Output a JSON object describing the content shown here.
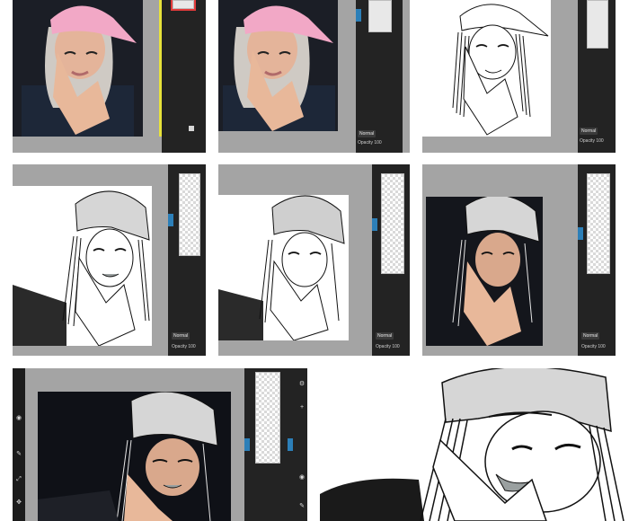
{
  "layer_panel": {
    "blend_mode": "Normal",
    "opacity_label": "Opacity 100"
  },
  "icons": {
    "trash": "trash-icon",
    "eye": "eye-icon",
    "brush": "brush-icon",
    "settings": "gear-icon",
    "add_layer": "add-layer-icon"
  },
  "colors": {
    "workspace_gray": "#a4a4a4",
    "panel_dark": "#232323",
    "accent_blue": "#2c7fb8",
    "selection_red": "#e23b3b",
    "cap_pink": "#f2a8c6",
    "cap_gray": "#d6d6d6",
    "lip_gray": "#9aa0a0",
    "skin_tone": "#e8b89a"
  },
  "steps": [
    {
      "step": 1,
      "description_id": "original-photo"
    },
    {
      "step": 2,
      "description_id": "photo-with-layer"
    },
    {
      "step": 3,
      "description_id": "line-sketch"
    },
    {
      "step": 4,
      "description_id": "sketch-gray-cap"
    },
    {
      "step": 5,
      "description_id": "sketch-gray-cap-shaded"
    },
    {
      "step": 6,
      "description_id": "sketch-over-photo"
    },
    {
      "step": 7,
      "description_id": "full-toolbar-view"
    },
    {
      "step": 8,
      "description_id": "final-result"
    }
  ]
}
